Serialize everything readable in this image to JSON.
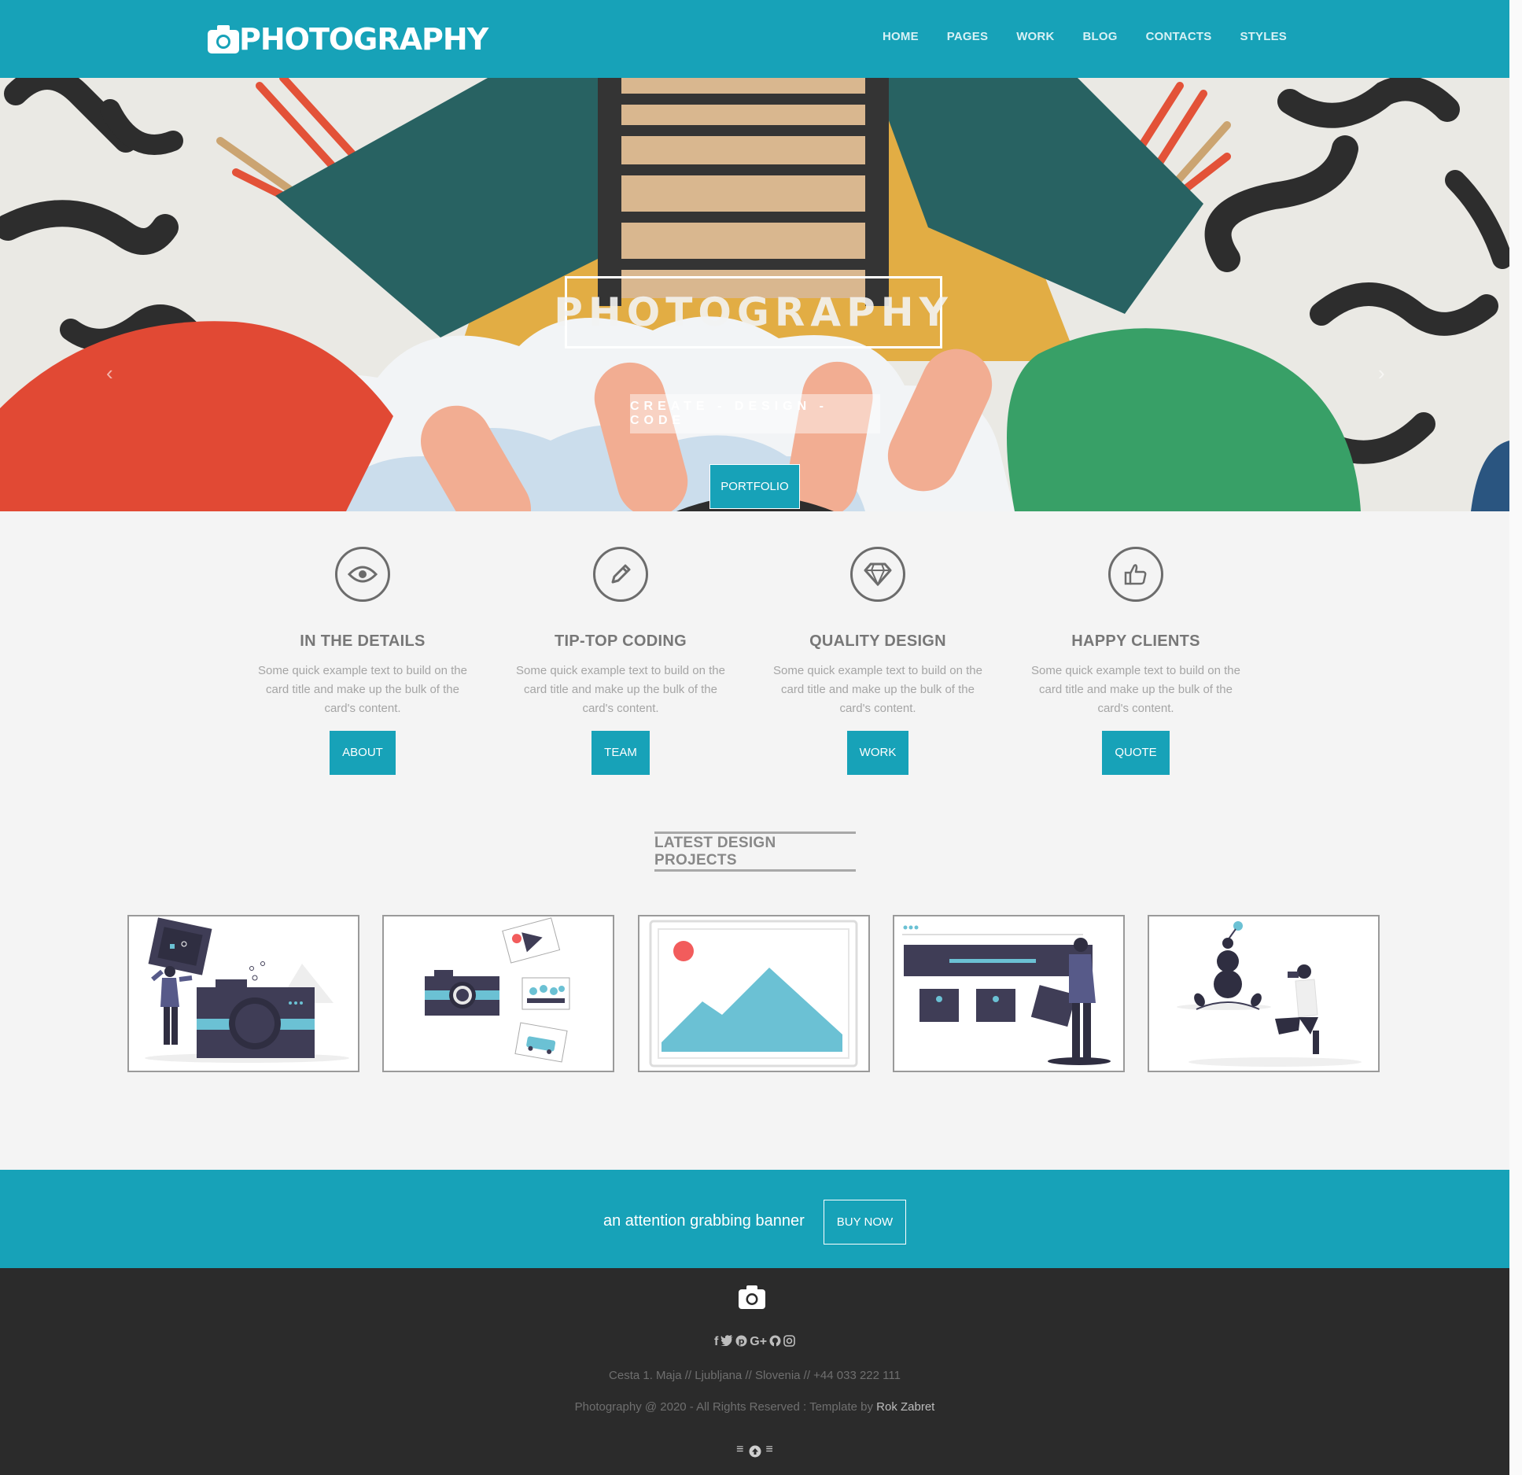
{
  "navbar": {
    "brand": "PHOTOGRAPHY",
    "items": [
      "HOME",
      "PAGES",
      "WORK",
      "BLOG",
      "CONTACTS",
      "STYLES"
    ]
  },
  "hero": {
    "title": "PHOTOGRAPHY",
    "subtitle": "CREATE - DESIGN - CODE",
    "button": "PORTFOLIO",
    "slide_count": 3,
    "active_slide": 1
  },
  "features": [
    {
      "icon": "eye-icon",
      "title": "IN THE DETAILS",
      "text": "Some quick example text to build on the card title and make up the bulk of the card's content.",
      "button": "ABOUT"
    },
    {
      "icon": "pencil-icon",
      "title": "TIP-TOP CODING",
      "text": "Some quick example text to build on the card title and make up the bulk of the card's content.",
      "button": "TEAM"
    },
    {
      "icon": "diamond-icon",
      "title": "QUALITY DESIGN",
      "text": "Some quick example text to build on the card title and make up the bulk of the card's content.",
      "button": "WORK"
    },
    {
      "icon": "thumbs-up-icon",
      "title": "HAPPY CLIENTS",
      "text": "Some quick example text to build on the card title and make up the bulk of the card's content.",
      "button": "QUOTE"
    }
  ],
  "projects_title": "LATEST DESIGN PROJECTS",
  "banner": {
    "text": "an attention grabbing banner",
    "button": "BUY NOW"
  },
  "footer": {
    "social": [
      "facebook-icon",
      "twitter-icon",
      "pinterest-icon",
      "google-plus-icon",
      "github-icon",
      "instagram-icon"
    ],
    "address": "Cesta 1. Maja // Ljubljana // Slovenia // +44 033 222 111",
    "copyright": "Photography @ 2020 - All Rights Reserved : Template by ",
    "author": "Rok Zabret"
  },
  "colors": {
    "primary": "#17a2b8",
    "footer": "#2b2b2b",
    "background": "#f4f4f4"
  }
}
